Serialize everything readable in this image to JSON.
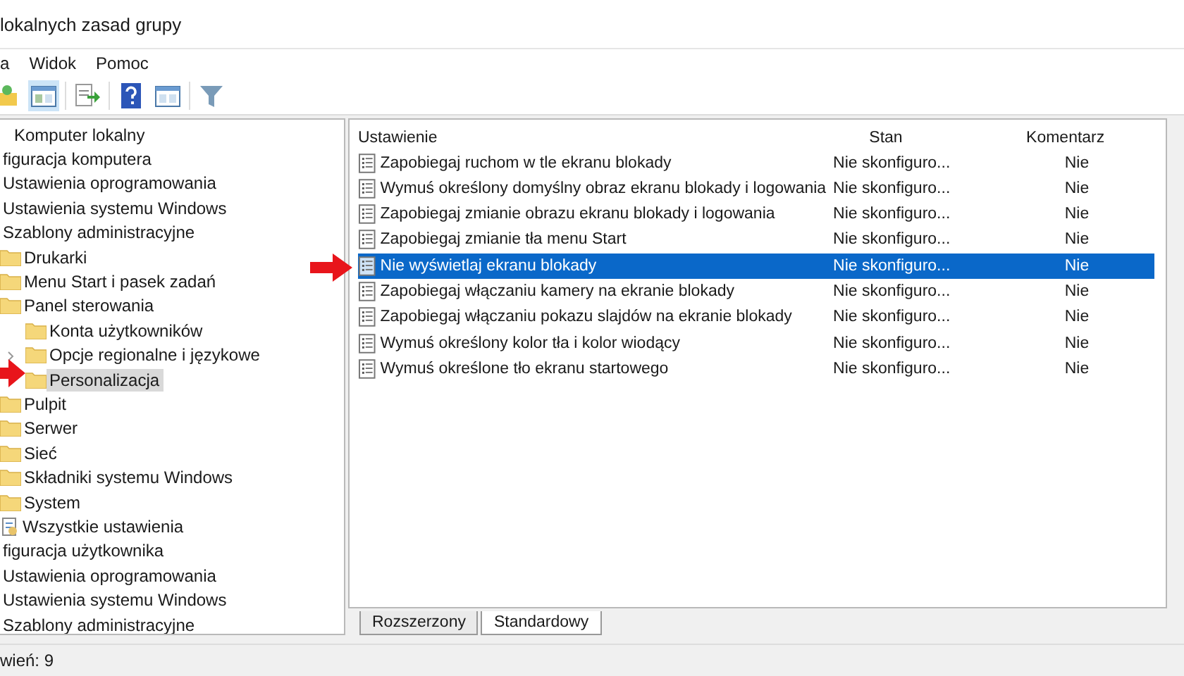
{
  "window": {
    "title": "lokalnych zasad grupy"
  },
  "menu": [
    "a",
    "Widok",
    "Pomoc"
  ],
  "toolbar": [
    {
      "kind": "folder-up",
      "selected": false
    },
    {
      "kind": "panel",
      "selected": true
    },
    {
      "kind": "export",
      "selected": false
    },
    {
      "kind": "help",
      "selected": false
    },
    {
      "kind": "panel2",
      "selected": false
    },
    {
      "kind": "filter",
      "selected": false
    }
  ],
  "tree": [
    {
      "label": "Komputer lokalny",
      "selected": false,
      "children": [
        {
          "label": "figuracja komputera",
          "selected": false,
          "children": [
            {
              "label": "Ustawienia oprogramowania",
              "selected": false
            },
            {
              "label": "Ustawienia systemu Windows",
              "selected": false
            },
            {
              "label": "Szablony administracyjne",
              "selected": false,
              "children": [
                {
                  "label": "Drukarki",
                  "kind": "folder",
                  "selected": false
                },
                {
                  "label": "Menu Start i pasek zadań",
                  "kind": "folder",
                  "selected": false
                },
                {
                  "label": "Panel sterowania",
                  "kind": "folder",
                  "selected": false,
                  "children": [
                    {
                      "label": "Konta użytkowników",
                      "kind": "folder",
                      "selected": false
                    },
                    {
                      "label": "Opcje regionalne i językowe",
                      "kind": "folder",
                      "selected": false,
                      "expandable": true
                    },
                    {
                      "label": "Personalizacja",
                      "kind": "folder",
                      "selected": true
                    }
                  ]
                },
                {
                  "label": "Pulpit",
                  "kind": "folder",
                  "selected": false
                },
                {
                  "label": "Serwer",
                  "kind": "folder",
                  "selected": false
                },
                {
                  "label": "Sieć",
                  "kind": "folder",
                  "selected": false
                },
                {
                  "label": "Składniki systemu Windows",
                  "kind": "folder",
                  "selected": false
                },
                {
                  "label": "System",
                  "kind": "folder",
                  "selected": false
                },
                {
                  "label": "Wszystkie ustawienia",
                  "kind": "settings",
                  "selected": false
                }
              ]
            }
          ]
        },
        {
          "label": "figuracja użytkownika",
          "selected": false,
          "children": [
            {
              "label": "Ustawienia oprogramowania",
              "selected": false
            },
            {
              "label": "Ustawienia systemu Windows",
              "selected": false
            },
            {
              "label": "Szablony administracyjne",
              "selected": false
            }
          ]
        }
      ]
    }
  ],
  "table": {
    "columns": [
      "Ustawienie",
      "Stan",
      "Komentarz"
    ],
    "rows": [
      {
        "setting": "Zapobiegaj ruchom w tle ekranu blokady",
        "state": "Nie skonfiguro...",
        "comment": "Nie",
        "selected": false
      },
      {
        "setting": "Wymuś określony domyślny obraz ekranu blokady i logowania",
        "state": "Nie skonfiguro...",
        "comment": "Nie",
        "selected": false
      },
      {
        "setting": "Zapobiegaj zmianie obrazu ekranu blokady i logowania",
        "state": "Nie skonfiguro...",
        "comment": "Nie",
        "selected": false
      },
      {
        "setting": "Zapobiegaj zmianie tła menu Start",
        "state": "Nie skonfiguro...",
        "comment": "Nie",
        "selected": false
      },
      {
        "setting": "Nie wyświetlaj ekranu blokady",
        "state": "Nie skonfiguro...",
        "comment": "Nie",
        "selected": true
      },
      {
        "setting": "Zapobiegaj włączaniu kamery na ekranie blokady",
        "state": "Nie skonfiguro...",
        "comment": "Nie",
        "selected": false
      },
      {
        "setting": "Zapobiegaj włączaniu pokazu slajdów na ekranie blokady",
        "state": "Nie skonfiguro...",
        "comment": "Nie",
        "selected": false
      },
      {
        "setting": "Wymuś określony kolor tła i kolor wiodący",
        "state": "Nie skonfiguro...",
        "comment": "Nie",
        "selected": false
      },
      {
        "setting": "Wymuś określone tło ekranu startowego",
        "state": "Nie skonfiguro...",
        "comment": "Nie",
        "selected": false
      }
    ]
  },
  "tabs": [
    {
      "label": "Rozszerzony",
      "selected": false
    },
    {
      "label": "Standardowy",
      "selected": true
    }
  ],
  "status_bar": "wień: 9"
}
